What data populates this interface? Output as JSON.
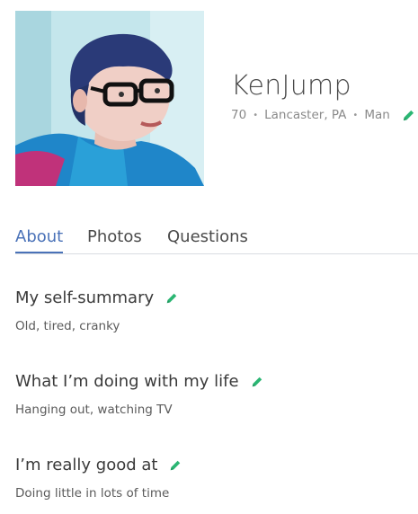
{
  "profile": {
    "username": "KenJump",
    "age": "70",
    "location": "Lancaster, PA",
    "gender": "Man",
    "separator": "•"
  },
  "tabs": [
    {
      "label": "About",
      "active": true
    },
    {
      "label": "Photos",
      "active": false
    },
    {
      "label": "Questions",
      "active": false
    }
  ],
  "sections": [
    {
      "title": "My self-summary",
      "body": "Old, tired, cranky"
    },
    {
      "title": "What I’m doing with my life",
      "body": "Hanging out, watching TV"
    },
    {
      "title": "I’m really good at",
      "body": "Doing little in lots of time"
    }
  ],
  "icons": {
    "edit": "pencil-icon"
  },
  "colors": {
    "accent": "#4a72b8",
    "edit_icon": "#2bb673",
    "text": "#3a3a3a",
    "muted": "#8a8a8a"
  }
}
